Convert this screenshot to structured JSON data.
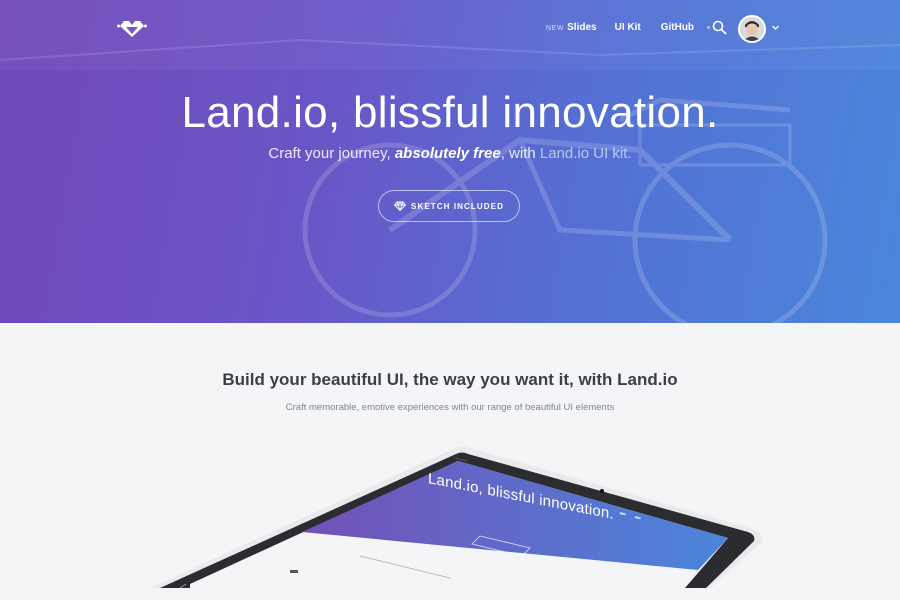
{
  "nav": {
    "links": [
      {
        "badge": "NEW",
        "label": "Slides"
      },
      {
        "label": "UI Kit"
      },
      {
        "label": "GitHub"
      }
    ],
    "search_icon": "search-icon",
    "avatar_icon": "avatar",
    "caret_icon": "chevron-down-icon"
  },
  "hero": {
    "title": "Land.io, blissful innovation.",
    "subtitle_pre": "Craft your journey, ",
    "subtitle_em": "absolutely free",
    "subtitle_mid": ", with ",
    "subtitle_link": "Land.io UI kit.",
    "cta_label": "SKETCH INCLUDED",
    "cta_icon": "diamond-icon"
  },
  "section": {
    "title": "Build your beautiful UI, the way you want it, with Land.io",
    "subtitle": "Craft memorable, emotive experiences with our range of beautiful UI elements"
  },
  "device": {
    "screen_title": "Land.io, blissful innovation."
  },
  "colors": {
    "hero_start": "#7149b8",
    "hero_end": "#4a86da",
    "page_bg": "#f4f5f7",
    "text_dark": "#3c3f47"
  }
}
